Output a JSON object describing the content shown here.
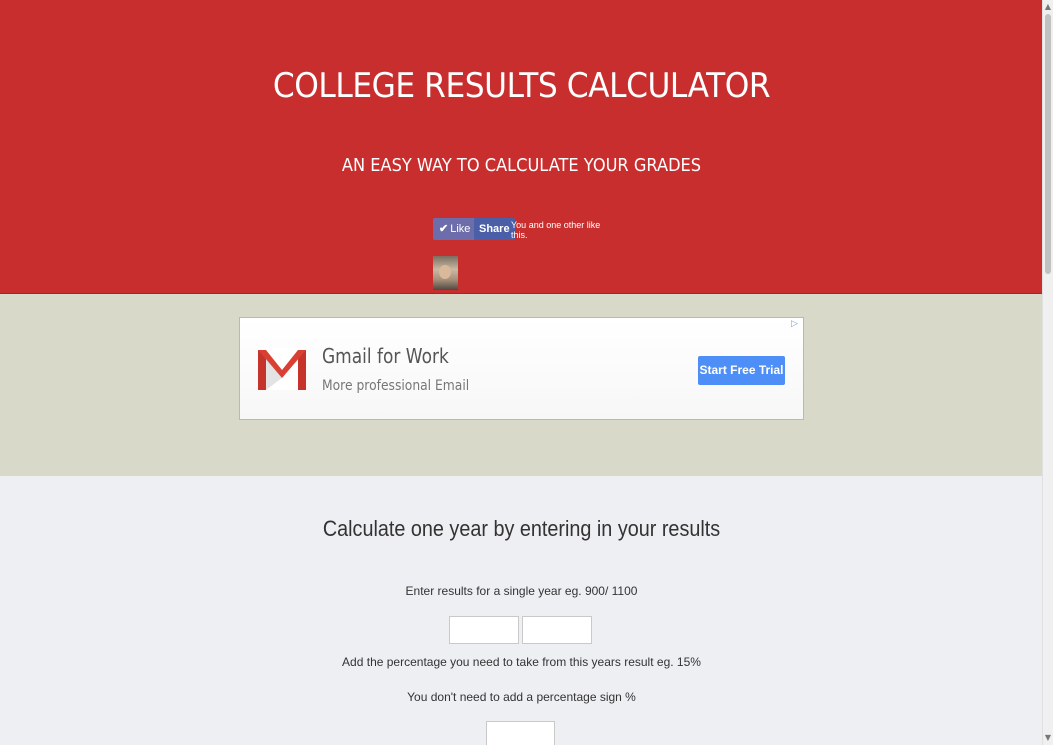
{
  "header": {
    "title": "COLLEGE RESULTS CALCULATOR",
    "subtitle": "AN EASY WAY TO CALCULATE YOUR GRADES"
  },
  "facebook": {
    "like_label": "Like",
    "share_label": "Share",
    "social_text": "You and one other like this.",
    "like_color": "#6d6dab",
    "share_color": "#4a5fa8"
  },
  "ad": {
    "title": "Gmail for Work",
    "subtitle": "More professional Email",
    "cta_label": "Start Free Trial",
    "cta_color": "#4d8ff7"
  },
  "calculator": {
    "title": "Calculate one year by entering in your results",
    "results_label": "Enter results for a single year eg. 900/ 1100",
    "result_obtained": {
      "value": "",
      "placeholder": ""
    },
    "result_total": {
      "value": "",
      "placeholder": ""
    },
    "percentage_label": "Add the percentage you need to take from this years result eg. 15%",
    "percentage_note": "You don't need to add a percentage sign %",
    "percentage_input": {
      "value": "",
      "placeholder": ""
    }
  },
  "colors": {
    "header_bg": "#c92e2e",
    "ad_band_bg": "#d8d9c9",
    "main_bg": "#eeeff3"
  }
}
